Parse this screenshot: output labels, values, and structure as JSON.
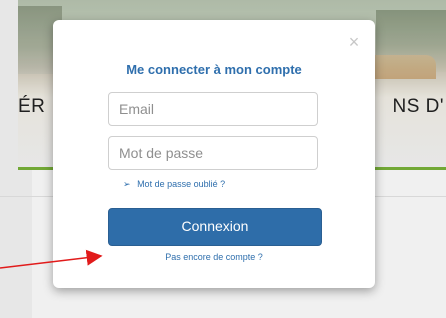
{
  "background": {
    "banner_title_left": "ÉR",
    "banner_title_right": "NS D'"
  },
  "modal": {
    "close_label": "×",
    "title": "Me connecter à mon compte",
    "email_placeholder": "Email",
    "password_placeholder": "Mot de passe",
    "forgot_arrow": "➢",
    "forgot_label": "Mot de passe oublié ?",
    "login_button_label": "Connexion",
    "signup_label": "Pas encore de compte ?"
  },
  "colors": {
    "accent_blue": "#2e6da9",
    "annotation_red": "#e11b1b",
    "banner_green_line": "#7ab33a"
  }
}
